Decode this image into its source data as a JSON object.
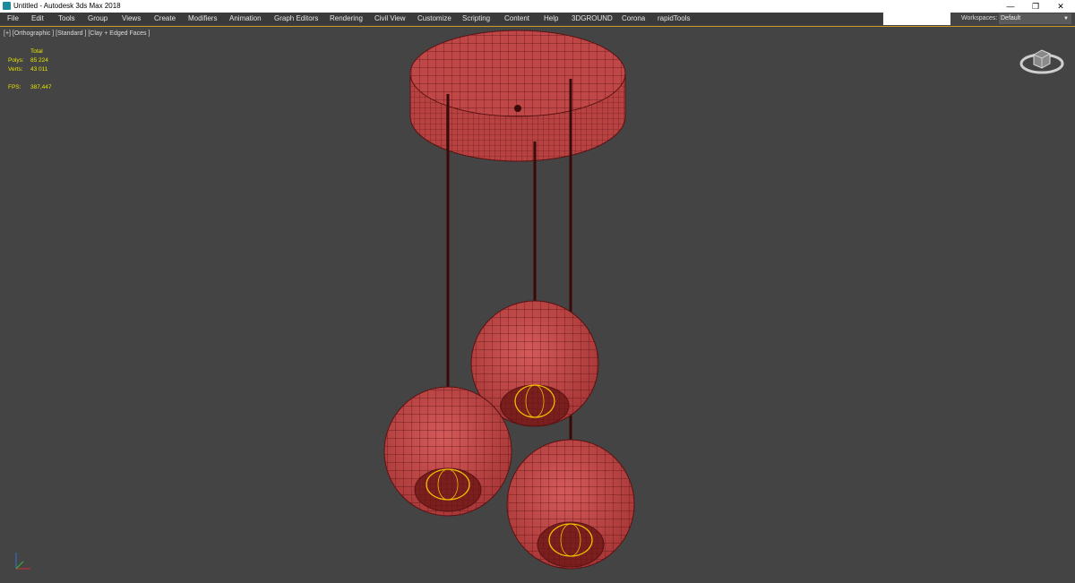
{
  "window": {
    "title": "Untitled - Autodesk 3ds Max 2018",
    "app_icon": "3ds-max-icon",
    "controls": {
      "minimize": "—",
      "restore": "❐",
      "close": "✕"
    }
  },
  "menu": {
    "items": [
      {
        "label": "File"
      },
      {
        "label": "Edit"
      },
      {
        "label": "Tools"
      },
      {
        "label": "Group"
      },
      {
        "label": "Views"
      },
      {
        "label": "Create"
      },
      {
        "label": "Modifiers"
      },
      {
        "label": "Animation"
      },
      {
        "label": "Graph Editors"
      },
      {
        "label": "Rendering"
      },
      {
        "label": "Civil View"
      },
      {
        "label": "Customize"
      },
      {
        "label": "Scripting"
      },
      {
        "label": "Content"
      },
      {
        "label": "Help"
      },
      {
        "label": "3DGROUND"
      },
      {
        "label": "Corona"
      },
      {
        "label": "rapidTools"
      }
    ]
  },
  "workspaces": {
    "label": "Workspaces:",
    "value": "Default"
  },
  "viewport": {
    "label": "[+] [Orthographic ] [Standard ] [Clay + Edged Faces ]",
    "stats": {
      "header": "Total",
      "polys_label": "Polys:",
      "polys_value": "85 224",
      "verts_label": "Verts:",
      "verts_value": "43 011",
      "fps_label": "FPS:",
      "fps_value": "387,447"
    },
    "scene_colors": {
      "model": "#c04a4a",
      "wire": "#5a1212",
      "rod": "#3a0a0a",
      "selection": "#f0c000",
      "background": "#444444"
    }
  }
}
